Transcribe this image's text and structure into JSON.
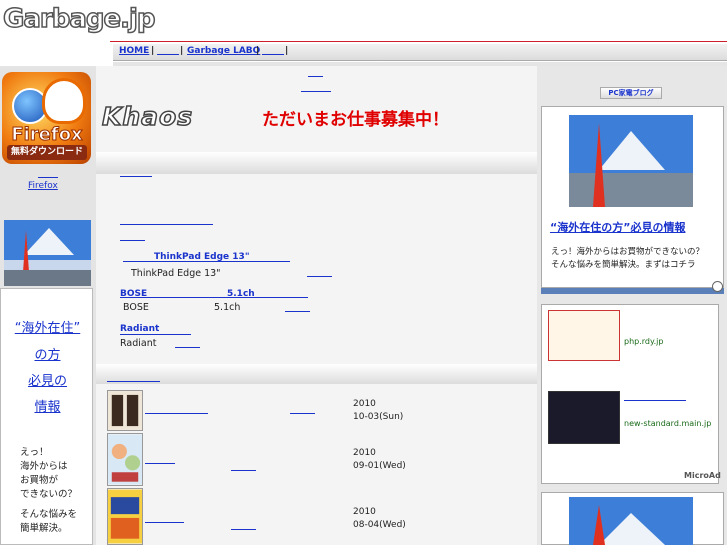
{
  "site": {
    "logo": "Garbage.jp"
  },
  "nav": {
    "home": "HOME",
    "sep": "|",
    "labo": "Garbage LABO"
  },
  "left": {
    "ff_badge_word": "Firefox",
    "ff_badge_sub": "無料ダウンロード",
    "ff_link": "Firefox",
    "ad_lines": [
      "“海外在住”",
      "の方",
      "必見の",
      "情報"
    ],
    "ad_small": [
      "えっ！",
      "海外からは",
      "お買物が",
      "できないの？",
      "そんな悩みを",
      "簡単解決。"
    ]
  },
  "center": {
    "khaos": "Khaos",
    "recruit": "ただいまお仕事募集中！",
    "items": [
      {
        "title": "ThinkPad Edge 13\"",
        "desc": "ThinkPad Edge 13\""
      },
      {
        "title": "BOSE",
        "title2": "5.1ch",
        "desc": "BOSE",
        "desc2": "5.1ch"
      },
      {
        "title": "Radiant",
        "desc": "Radiant"
      }
    ],
    "dates": [
      {
        "year": "2010",
        "date": "10-03(Sun)"
      },
      {
        "year": "2010",
        "date": "09-01(Wed)"
      },
      {
        "year": "2010",
        "date": "08-04(Wed)"
      }
    ],
    "ellipsis": "…"
  },
  "right": {
    "blog_icon": "PC家電ブログ",
    "ad_title": "“海外在住の方”必見の情報",
    "ad_text": [
      "えっ！海外からはお買物ができないの？",
      "そんな悩みを簡単解決。まずはコチラ"
    ],
    "ad2_domain1": "php.rdy.jp",
    "ad2_domain2": "new-standard.main.jp",
    "microad": "MicroAd"
  },
  "colors": {
    "accent_red": "#cc1f2a",
    "link": "#1a33cc",
    "recruit_red": "#e00000"
  }
}
